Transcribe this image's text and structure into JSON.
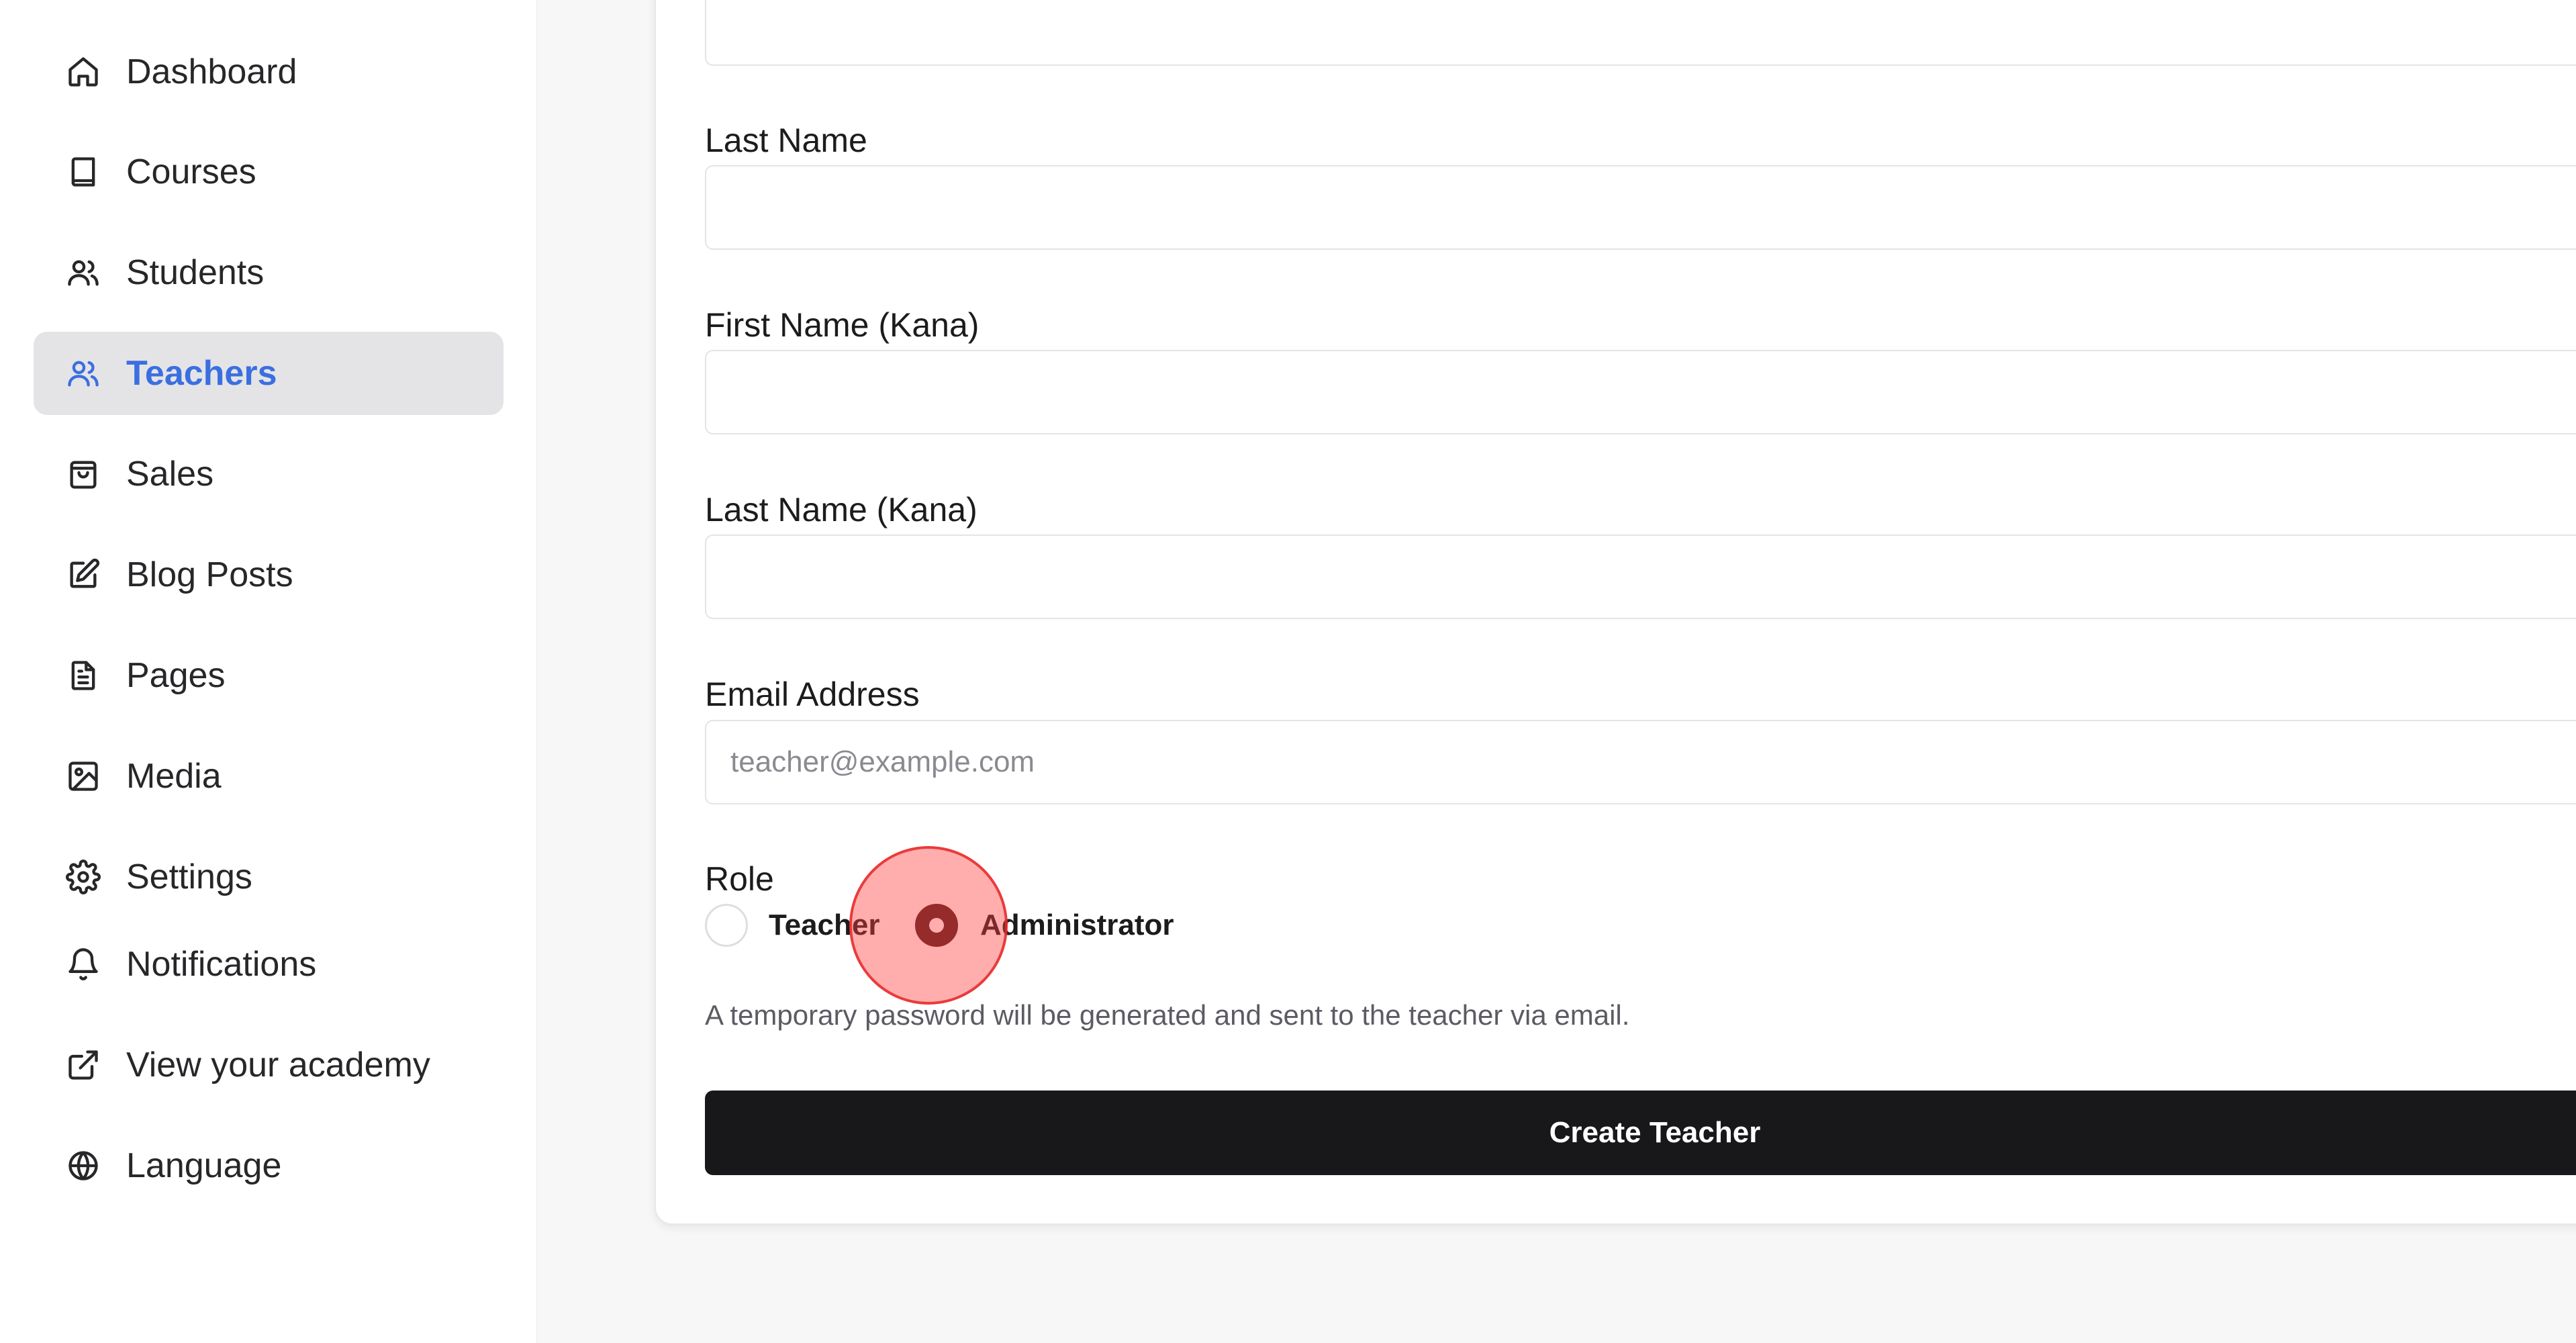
{
  "sidebar": {
    "items": [
      {
        "label": "Dashboard",
        "icon": "home-icon",
        "active": false
      },
      {
        "label": "Courses",
        "icon": "book-icon",
        "active": false
      },
      {
        "label": "Students",
        "icon": "users-icon",
        "active": false
      },
      {
        "label": "Teachers",
        "icon": "users-icon",
        "active": true
      },
      {
        "label": "Sales",
        "icon": "shopping-bag-icon",
        "active": false
      },
      {
        "label": "Blog Posts",
        "icon": "edit-icon",
        "active": false
      },
      {
        "label": "Pages",
        "icon": "file-text-icon",
        "active": false
      },
      {
        "label": "Media",
        "icon": "image-icon",
        "active": false
      },
      {
        "label": "Settings",
        "icon": "gear-icon",
        "active": false
      },
      {
        "label": "Notifications",
        "icon": "bell-icon",
        "active": false
      },
      {
        "label": "View your academy",
        "icon": "external-link-icon",
        "active": false
      },
      {
        "label": "Language",
        "icon": "globe-icon",
        "active": false
      }
    ],
    "active_color": "#3b6fe0"
  },
  "form": {
    "first_name": {
      "value": ""
    },
    "last_name": {
      "label": "Last Name",
      "value": ""
    },
    "first_name_kana": {
      "label": "First Name (Kana)",
      "value": ""
    },
    "last_name_kana": {
      "label": "Last Name (Kana)",
      "value": ""
    },
    "email": {
      "label": "Email Address",
      "value": "",
      "placeholder": "teacher@example.com"
    },
    "role": {
      "label": "Role",
      "options": [
        {
          "label": "Teacher",
          "checked": false
        },
        {
          "label": "Administrator",
          "checked": true
        }
      ]
    },
    "help_text": "A temporary password will be generated and sent to the teacher via email.",
    "submit_label": "Create Teacher"
  }
}
